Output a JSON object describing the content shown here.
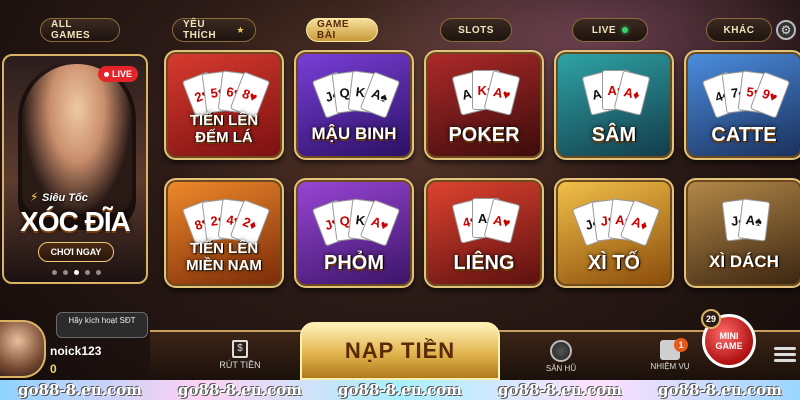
{
  "tabs": [
    {
      "label": "ALL GAMES",
      "active": false
    },
    {
      "label": "YÊU THÍCH",
      "active": false,
      "has_star": true
    },
    {
      "label": "GAME BÀI",
      "active": true
    },
    {
      "label": "SLOTS",
      "active": false
    },
    {
      "label": "LIVE",
      "active": false,
      "has_dot": true
    },
    {
      "label": "KHÁC",
      "active": false
    }
  ],
  "featured": {
    "live_label": "LIVE",
    "subtitle": "Siêu Tốc",
    "title": "XÓC ĐĨA",
    "cta_label": "CHƠI NGAY"
  },
  "games": [
    {
      "name": "TIẾN LÊN ĐẾM LÁ",
      "theme": "red",
      "cards": [
        "2♥",
        "5♥",
        "6♥",
        "8♥"
      ]
    },
    {
      "name": "MẬU BINH",
      "theme": "purple",
      "cards": [
        "J♠",
        "Q♠",
        "K♠",
        "A♠"
      ]
    },
    {
      "name": "POKER",
      "theme": "maroon",
      "cards": [
        "A♠",
        "K♥",
        "A♥"
      ]
    },
    {
      "name": "SÂM",
      "theme": "teal",
      "cards": [
        "A♠",
        "A♥",
        "A♦"
      ]
    },
    {
      "name": "CATTE",
      "theme": "blue",
      "cards": [
        "4♠",
        "7♠",
        "5♥",
        "9♥"
      ]
    },
    {
      "name": "TIẾN LÊN MIỀN NAM",
      "theme": "orange",
      "cards": [
        "8♥",
        "2♥",
        "4♥",
        "2♦"
      ]
    },
    {
      "name": "PHỎM",
      "theme": "violet",
      "cards": [
        "J♥",
        "Q♦",
        "K♠",
        "A♥"
      ]
    },
    {
      "name": "LIÊNG",
      "theme": "crimson",
      "cards": [
        "4♥",
        "A♠",
        "A♥"
      ]
    },
    {
      "name": "XÌ TỐ",
      "theme": "gold",
      "cards": [
        "J♠",
        "J♥",
        "A♥",
        "A♦"
      ]
    },
    {
      "name": "XÌ DÁCH",
      "theme": "bronze",
      "cards": [
        "J♠",
        "A♠"
      ]
    }
  ],
  "user": {
    "activate_text": "Hãy kích hoạt SĐT",
    "username": "noick123",
    "balance": "0"
  },
  "bottom_bar": {
    "withdraw_label": "RÚT TIỀN",
    "deposit_label": "NẠP TIỀN",
    "jackpot_label": "SĂN HŨ",
    "mission_label": "NHIỆM VỤ",
    "mission_badge": "1",
    "minigame_label": "MINI GAME",
    "minigame_badge": "29"
  },
  "watermark": [
    "go88-8.eu.com",
    "go88-8.eu.com",
    "go88-8.eu.com",
    "go88-8.eu.com",
    "go88-8.eu.com"
  ],
  "colors": {
    "accent_gold": "#e3c27a",
    "live_red": "#e3242b",
    "online_green": "#37d16b"
  }
}
